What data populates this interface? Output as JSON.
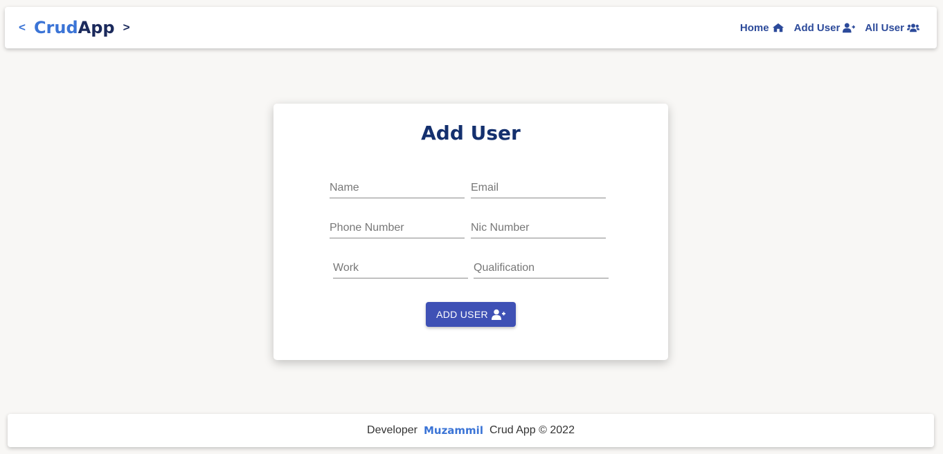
{
  "navbar": {
    "brand_prefix": "<",
    "brand_crud": "Crud",
    "brand_app": "App",
    "brand_suffix": ">",
    "links": [
      {
        "label": "Home",
        "icon": "home-icon"
      },
      {
        "label": "Add User",
        "icon": "user-plus-icon"
      },
      {
        "label": "All User",
        "icon": "users-icon"
      }
    ]
  },
  "form": {
    "title": "Add User",
    "fields": {
      "name": {
        "placeholder": "Name",
        "value": ""
      },
      "email": {
        "placeholder": "Email",
        "value": ""
      },
      "phone": {
        "placeholder": "Phone Number",
        "value": ""
      },
      "nic": {
        "placeholder": "Nic Number",
        "value": ""
      },
      "work": {
        "placeholder": "Work",
        "value": ""
      },
      "qualification": {
        "placeholder": "Qualification",
        "value": ""
      }
    },
    "submit_label": "ADD USER",
    "submit_icon": "user-plus-icon"
  },
  "footer": {
    "prefix": "Developer",
    "developer": "Muzammil",
    "suffix": "Crud App © 2022"
  },
  "colors": {
    "accent": "#3f51b5",
    "brand_light": "#3b74d6",
    "brand_dark": "#1b2a5c",
    "title": "#14306e"
  }
}
